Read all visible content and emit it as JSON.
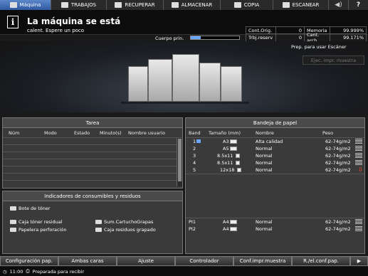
{
  "tabs": [
    {
      "label": "Máquina",
      "icon": "machine-icon"
    },
    {
      "label": "TRABAJOS",
      "icon": "jobs-icon"
    },
    {
      "label": "RECUPERAR",
      "icon": "recall-icon"
    },
    {
      "label": "ALMACENAR",
      "icon": "store-icon"
    },
    {
      "label": "COPIA",
      "icon": "copy-icon"
    },
    {
      "label": "ESCANEAR",
      "icon": "scan-icon"
    }
  ],
  "status": {
    "title": "La máquina se está",
    "subtitle": "calent. Espere un poco",
    "cuerpo_label": "Cuerpo prin.",
    "toner_level_fraction": 0.2,
    "prep_text": "Prep. para usar Escáner",
    "ejec_button": "Ejec. impr. muestra"
  },
  "counters": {
    "cont_orig_label": "Cont.Orig.",
    "cont_orig_value": "0",
    "memoria_label": "Memoria",
    "memoria_value": "99.999%",
    "trbj_label": "Trbj.reserv",
    "trbj_value": "0",
    "cant_label": "Cant. arch.",
    "cant_value": "99.171%"
  },
  "tarea": {
    "title": "Tarea",
    "headers": [
      "Núm",
      "Modo",
      "Estado",
      "Minuto(s)",
      "Nombre usuario"
    ]
  },
  "bandeja": {
    "title": "Bandeja de papel",
    "headers": [
      "Band",
      "Tamaño (mm)",
      "Nombre",
      "Peso"
    ],
    "rows": [
      {
        "band": "1",
        "size": "A3",
        "name": "Alta calidad",
        "weight": "62-74g/m2"
      },
      {
        "band": "2",
        "size": "A5",
        "name": "Normal",
        "weight": "62-74g/m2"
      },
      {
        "band": "3",
        "size": "8.5x11",
        "name": "Normal",
        "weight": "62-74g/m2"
      },
      {
        "band": "4",
        "size": "8.5x11",
        "name": "Normal",
        "weight": "62-74g/m2"
      },
      {
        "band": "5",
        "size": "12x18",
        "name": "Normal",
        "weight": "62-74g/m2"
      }
    ],
    "pi_rows": [
      {
        "band": "PI1",
        "size": "A4",
        "name": "Normal",
        "weight": "62-74g/m2"
      },
      {
        "band": "PI2",
        "size": "A4",
        "name": "Normal",
        "weight": "62-74g/m2"
      }
    ]
  },
  "consumibles": {
    "title": "Indicadores de consumibles y residuos",
    "bote_toner": "Bote de tóner",
    "caja_toner": "Caja tóner residual",
    "papelera": "Papelera perforación",
    "sum_cartucho": "Sum.CartuchoGrapas",
    "caja_residuos": "Caja residuos grapado"
  },
  "buttons": [
    "Configuración pap.",
    "Ambas caras",
    "Ajuste",
    "Controlador",
    "Conf.impr.muestra",
    "R./el.conf.pap."
  ],
  "footer": {
    "time": "11:00",
    "status": "Preparada para recibir"
  },
  "colors": {
    "active_tab": "#3f6db8",
    "accent_blue": "#6aa8ff",
    "warning_red": "#e0402a"
  }
}
